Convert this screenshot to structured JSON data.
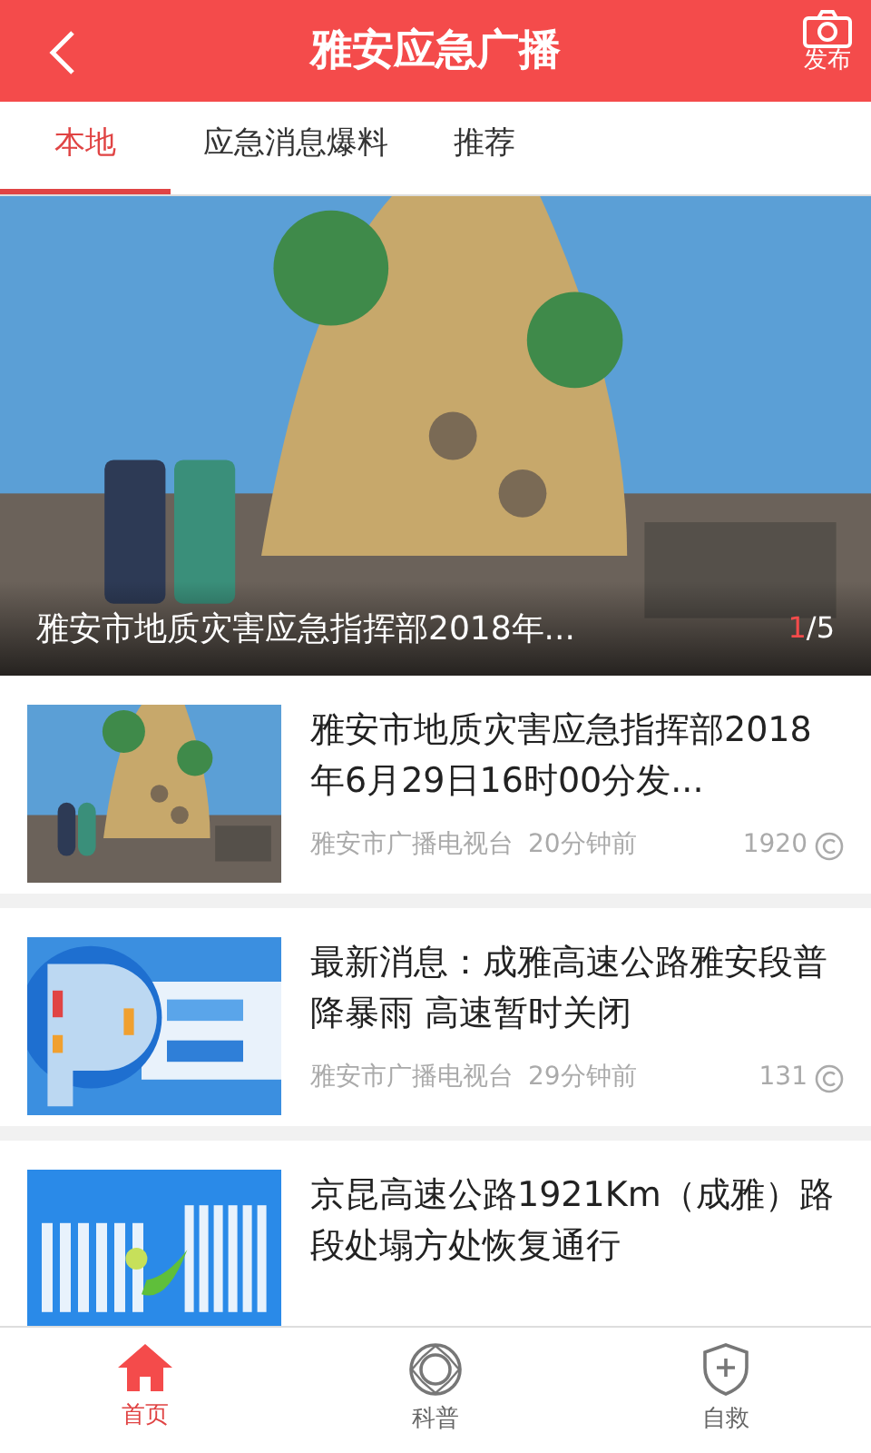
{
  "header": {
    "title": "雅安应急广播",
    "action_label": "发布"
  },
  "tabs": [
    {
      "label": "本地",
      "selected": true
    },
    {
      "label": "应急消息爆料",
      "selected": false
    },
    {
      "label": "推荐",
      "selected": false
    }
  ],
  "banner": {
    "kind": "picture",
    "caption": "雅安市地质灾害应急指挥部2018年...",
    "page_current": "1",
    "page_rest": "/5"
  },
  "articles": [
    {
      "title": "雅安市地质灾害应急指挥部2018年6月29日16时00分发...",
      "source": "雅安市广播电视台",
      "time": "20分钟前",
      "views": "1920"
    },
    {
      "title": "最新消息：成雅高速公路雅安段普降暴雨  高速暂时关闭",
      "source": "雅安市广播电视台",
      "time": "29分钟前",
      "views": "131"
    },
    {
      "title": "京昆高速公路1921Km（成雅）路段处塌方处恢复通行"
    }
  ],
  "bottom_nav": [
    {
      "label": "首页",
      "selected": true
    },
    {
      "label": "科普",
      "selected": false
    },
    {
      "label": "自救",
      "selected": false
    }
  ]
}
